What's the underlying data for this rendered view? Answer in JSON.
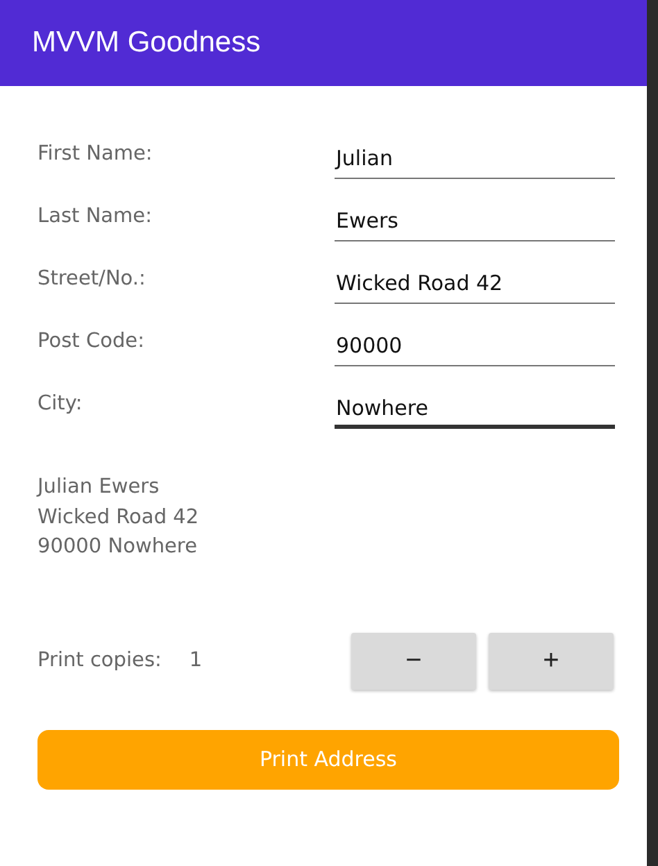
{
  "header": {
    "title": "MVVM Goodness"
  },
  "fields": [
    {
      "label": "First Name:",
      "value": "Julian",
      "focused": false
    },
    {
      "label": "Last Name:",
      "value": "Ewers",
      "focused": false
    },
    {
      "label": "Street/No.:",
      "value": "Wicked Road 42",
      "focused": false
    },
    {
      "label": "Post Code:",
      "value": "90000",
      "focused": false
    },
    {
      "label": "City:",
      "value": "Nowhere",
      "focused": true
    }
  ],
  "address_lines": [
    "Julian Ewers",
    "Wicked Road 42",
    "90000 Nowhere"
  ],
  "copies": {
    "label": "Print copies:",
    "value": "1",
    "decrease": "−",
    "increase": "+"
  },
  "print_button": "Print Address"
}
